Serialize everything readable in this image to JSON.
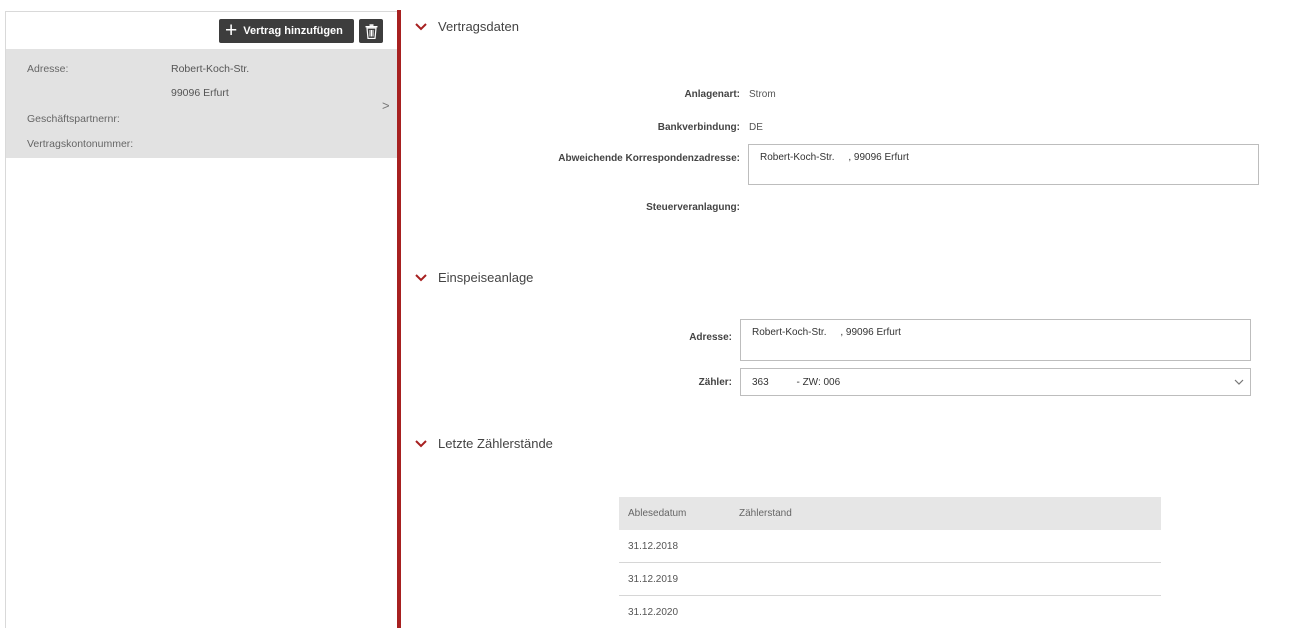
{
  "toolbar": {
    "add_contract_label": "Vertrag hinzufügen"
  },
  "contract_card": {
    "address_label": "Adresse:",
    "address_line1": "Robert-Koch-Str.",
    "address_line2": "99096 Erfurt",
    "partner_label": "Geschäftspartnernr:",
    "account_label": "Vertragskontonummer:",
    "chevron": ">"
  },
  "sections": {
    "contract": {
      "title": "Vertragsdaten",
      "fields": {
        "plant_type_label": "Anlagenart:",
        "plant_type_value": "Strom",
        "bank_label": "Bankverbindung:",
        "bank_value": "DE",
        "corr_address_label": "Abweichende Korrespondenzadresse:",
        "corr_address_value": "Robert-Koch-Str.     , 99096 Erfurt",
        "tax_label": "Steuerveranlagung:"
      }
    },
    "feed_in": {
      "title": "Einspeiseanlage",
      "fields": {
        "address_label": "Adresse:",
        "address_value": "Robert-Koch-Str.     , 99096 Erfurt",
        "meter_label": "Zähler:",
        "meter_value": "363          - ZW: 006"
      }
    },
    "readings": {
      "title": "Letzte Zählerstände",
      "columns": [
        "Ablesedatum",
        "Zählerstand"
      ],
      "rows": [
        {
          "date": "31.12.2018",
          "value": ""
        },
        {
          "date": "31.12.2019",
          "value": ""
        },
        {
          "date": "31.12.2020",
          "value": ""
        }
      ]
    }
  },
  "colors": {
    "accent": "#a72020",
    "button_bg": "#3d3d3d",
    "card_bg": "#e2e2e2"
  }
}
